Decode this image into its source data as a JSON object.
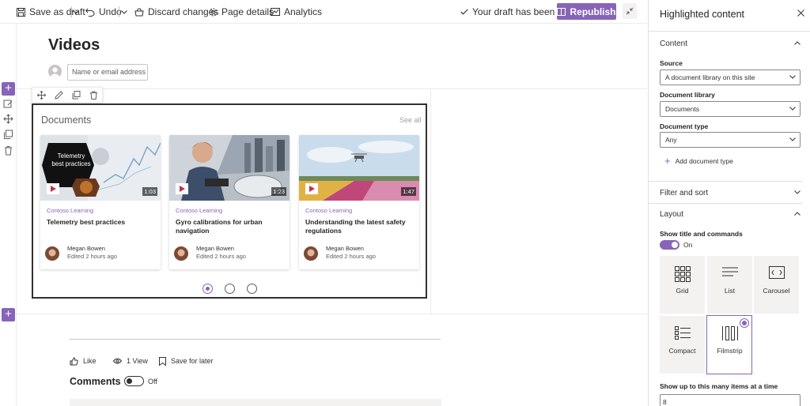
{
  "toolbar": {
    "save_as_draft": "Save as draft",
    "undo": "Undo",
    "discard_changes": "Discard changes",
    "page_details": "Page details",
    "analytics": "Analytics",
    "draft_status": "Your draft has been saved",
    "republish": "Republish"
  },
  "page": {
    "title": "Videos",
    "author_placeholder": "Name or email address"
  },
  "webpart": {
    "title": "Documents",
    "see_all": "See all",
    "cards": [
      {
        "thumb_text": "Telemetry best practices",
        "duration": "1:03",
        "site": "Contoso Learning",
        "title": "Telemetry best practices",
        "author": "Megan Bowen",
        "edited": "Edited 2 hours ago"
      },
      {
        "duration": "1:23",
        "site": "Contoso Learning",
        "title": "Gyro calibrations for urban navigation",
        "author": "Megan Bowen",
        "edited": "Edited 2 hours ago"
      },
      {
        "duration": "1:47",
        "site": "Contoso Learning",
        "title": "Understanding the latest safety regulations",
        "author": "Megan Bowen",
        "edited": "Edited 2 hours ago"
      }
    ],
    "pages": 3,
    "current_page": 1
  },
  "social": {
    "like": "Like",
    "views": "1 View",
    "save_for_later": "Save for later",
    "comments": "Comments",
    "comments_toggle": "Off"
  },
  "panel": {
    "title": "Highlighted content",
    "content_section": "Content",
    "source_label": "Source",
    "source_value": "A document library on this site",
    "doclib_label": "Document library",
    "doclib_value": "Documents",
    "doctype_label": "Document type",
    "doctype_value": "Any",
    "add_doctype": "Add document type",
    "filter_section": "Filter and sort",
    "layout_section": "Layout",
    "show_title_label": "Show title and commands",
    "show_title_state": "On",
    "layouts": [
      "Grid",
      "List",
      "Carousel",
      "Compact",
      "Filmstrip"
    ],
    "selected_layout": "Filmstrip",
    "max_items_label": "Show up to this many items at a time",
    "max_items_value": "8"
  },
  "colors": {
    "accent": "#8764b8",
    "text": "#323130"
  }
}
